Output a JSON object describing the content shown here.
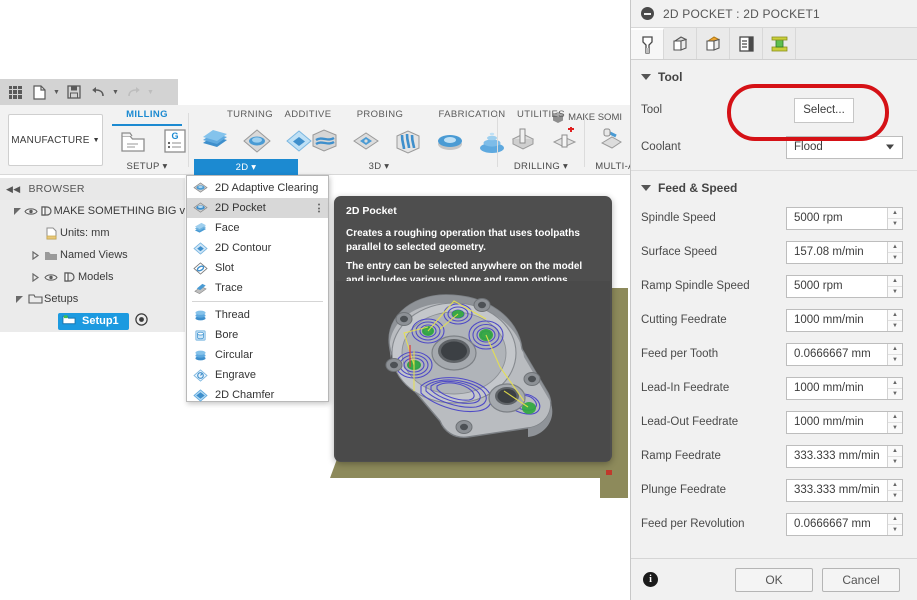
{
  "app": {
    "workspace_label": "MANUFACTURE",
    "make_something_label": "MAKE SOMI"
  },
  "quick_access": {
    "items": [
      {
        "name": "app-grid-icon",
        "label": ""
      },
      {
        "name": "new-file-icon",
        "label": ""
      },
      {
        "name": "save-icon",
        "label": ""
      },
      {
        "name": "undo-icon",
        "label": ""
      },
      {
        "name": "redo-icon",
        "label": ""
      }
    ]
  },
  "ribbon": {
    "groups": [
      {
        "title": "MILLING",
        "active": true,
        "label": "SETUP",
        "tab": ""
      },
      {
        "title": "",
        "active": false,
        "label": "",
        "tab": "2D"
      },
      {
        "title": "TURNING",
        "active": false,
        "label": "",
        "tab": ""
      },
      {
        "title": "ADDITIVE",
        "active": false,
        "label": "",
        "tab": ""
      },
      {
        "title": "PROBING",
        "active": false,
        "label": "",
        "tab": ""
      },
      {
        "title": "FABRICATION",
        "active": false,
        "label": "3D",
        "tab": ""
      },
      {
        "title": "UTILITIES",
        "active": false,
        "label": "DRILLING",
        "tab": ""
      },
      {
        "title": "",
        "active": false,
        "label": "MULTI-A",
        "tab": ""
      }
    ],
    "setup_label": "SETUP",
    "twod_label": "2D",
    "threed_label": "3D",
    "drilling_label": "DRILLING",
    "multiaxis_label": "MULTI-A",
    "milling_label": "MILLING",
    "turning_label": "TURNING",
    "additive_label": "ADDITIVE",
    "probing_label": "PROBING",
    "fabrication_label": "FABRICATION",
    "utilities_label": "UTILITIES"
  },
  "browser": {
    "header": "BROWSER",
    "items": [
      {
        "label": "MAKE SOMETHING BIG v",
        "indent": 0,
        "twisty": "open",
        "eye": true,
        "icon": "component-icon"
      },
      {
        "label": "Units: mm",
        "indent": 1,
        "twisty": "none",
        "eye": false,
        "icon": "document-icon"
      },
      {
        "label": "Named Views",
        "indent": 1,
        "twisty": "closed",
        "eye": false,
        "icon": "folder-icon"
      },
      {
        "label": "Models",
        "indent": 1,
        "twisty": "closed",
        "eye": true,
        "icon": "component-icon"
      },
      {
        "label": "Setups",
        "indent": 1,
        "twisty": "open",
        "eye": false,
        "icon": "setup-icon"
      },
      {
        "label": "Setup1",
        "indent": 2,
        "twisty": "none",
        "eye": false,
        "icon": "setup-icon",
        "selected": true
      }
    ]
  },
  "flyout_menu": {
    "items": [
      {
        "label": "2D Adaptive Clearing",
        "selected": false,
        "icon": "adaptive-clearing-icon"
      },
      {
        "label": "2D Pocket",
        "selected": true,
        "icon": "pocket-icon",
        "overflow": true
      },
      {
        "label": "Face",
        "selected": false,
        "icon": "face-icon"
      },
      {
        "label": "2D Contour",
        "selected": false,
        "icon": "contour-icon"
      },
      {
        "label": "Slot",
        "selected": false,
        "icon": "slot-icon"
      },
      {
        "label": "Trace",
        "selected": false,
        "icon": "trace-icon"
      },
      {
        "separator": true
      },
      {
        "label": "Thread",
        "selected": false,
        "icon": "thread-icon"
      },
      {
        "label": "Bore",
        "selected": false,
        "icon": "bore-icon"
      },
      {
        "label": "Circular",
        "selected": false,
        "icon": "circular-icon"
      },
      {
        "label": "Engrave",
        "selected": false,
        "icon": "engrave-icon"
      },
      {
        "label": "2D Chamfer",
        "selected": false,
        "icon": "chamfer-icon"
      }
    ]
  },
  "tooltip": {
    "title": "2D Pocket",
    "paragraph1": "Creates a roughing operation that uses toolpaths parallel to selected geometry.",
    "paragraph2": "The entry can be selected anywhere on the model and includes various plunge and ramp options."
  },
  "dialog": {
    "title": "2D POCKET : 2D POCKET1",
    "tabs": [
      {
        "name": "tool-tab",
        "icon": "endmill-icon",
        "active": true
      },
      {
        "name": "geometry-tab",
        "icon": "geometry-box-icon",
        "active": false
      },
      {
        "name": "heights-tab",
        "icon": "heights-box-icon",
        "active": false
      },
      {
        "name": "passes-tab",
        "icon": "passes-icon",
        "active": false
      },
      {
        "name": "linking-tab",
        "icon": "linking-icon",
        "active": false
      }
    ],
    "sections": [
      {
        "name": "tool",
        "title": "Tool",
        "rows": [
          {
            "label": "Tool",
            "type": "button",
            "value": "Select...",
            "highlighted": true
          },
          {
            "label": "Coolant",
            "type": "dropdown",
            "value": "Flood"
          }
        ]
      },
      {
        "name": "feed-and-speed",
        "title": "Feed & Speed",
        "rows": [
          {
            "label": "Spindle Speed",
            "type": "spinner",
            "value": "5000 rpm"
          },
          {
            "label": "Surface Speed",
            "type": "spinner",
            "value": "157.08 m/min"
          },
          {
            "label": "Ramp Spindle Speed",
            "type": "spinner",
            "value": "5000 rpm"
          },
          {
            "label": "Cutting Feedrate",
            "type": "spinner",
            "value": "1000 mm/min"
          },
          {
            "label": "Feed per Tooth",
            "type": "spinner",
            "value": "0.0666667 mm"
          },
          {
            "label": "Lead-In Feedrate",
            "type": "spinner",
            "value": "1000 mm/min"
          },
          {
            "label": "Lead-Out Feedrate",
            "type": "spinner",
            "value": "1000 mm/min"
          },
          {
            "label": "Ramp Feedrate",
            "type": "spinner",
            "value": "333.333 mm/min"
          },
          {
            "label": "Plunge Feedrate",
            "type": "spinner",
            "value": "333.333 mm/min"
          },
          {
            "label": "Feed per Revolution",
            "type": "spinner",
            "value": "0.0666667 mm"
          }
        ]
      }
    ],
    "footer": {
      "info_glyph": "i",
      "ok_label": "OK",
      "cancel_label": "Cancel"
    }
  },
  "colors": {
    "accent_blue": "#1c8ad1",
    "highlight_red": "#d51116",
    "selection_blue": "#1c9ae0",
    "tooltip_bg": "#4e4e4e",
    "panel_bg": "#f1f1f1",
    "stock_olive": "#8d8a5b"
  }
}
